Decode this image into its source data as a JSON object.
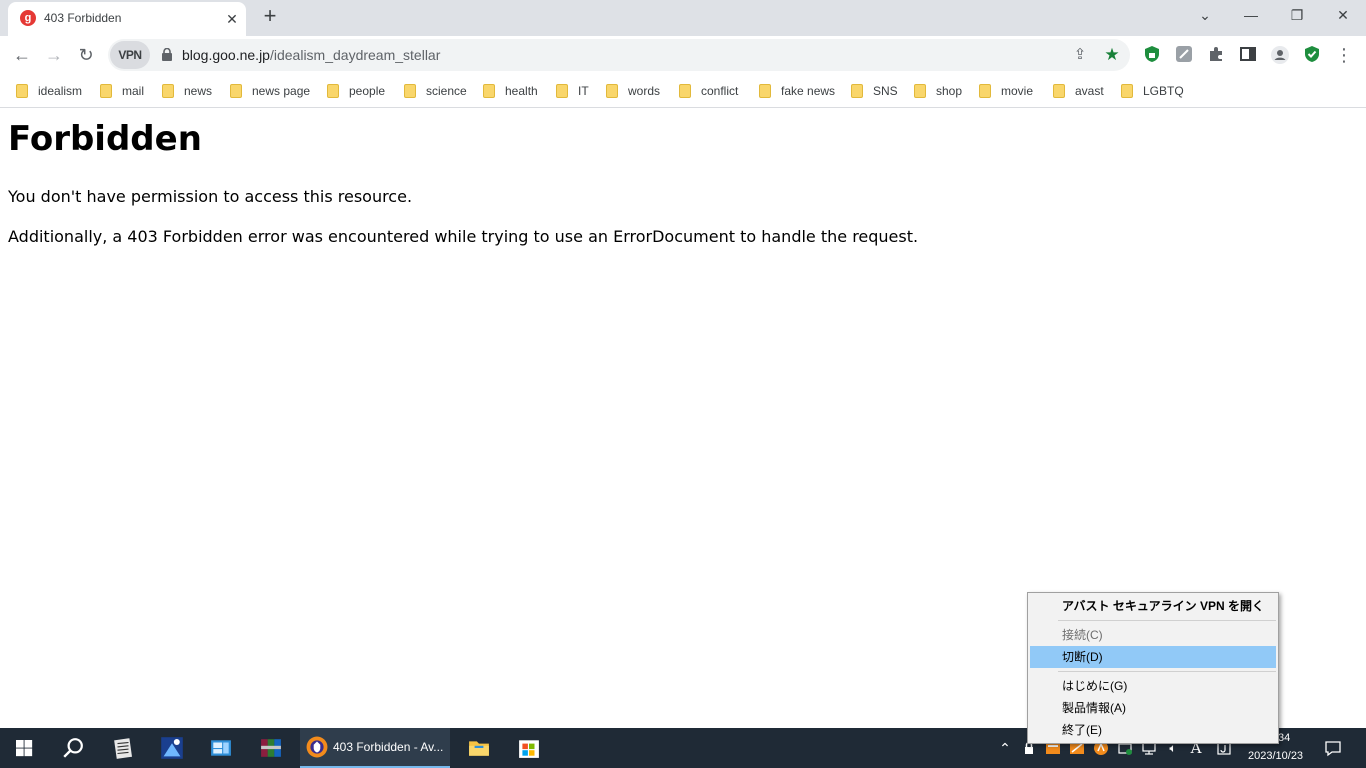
{
  "tab": {
    "title": "403 Forbidden",
    "favicon_icon": "goo-favicon-icon",
    "close_glyph": "✕"
  },
  "new_tab_glyph": "+",
  "window_controls": {
    "tabsearch": "⌄",
    "minimize": "—",
    "restore": "❐",
    "close": "✕"
  },
  "toolbar": {
    "back_glyph": "←",
    "forward_glyph": "→",
    "reload_glyph": "↻",
    "vpn_label": "VPN",
    "url_host": "blog.goo.ne.jp",
    "url_path": "/idealism_daydream_stellar",
    "share_glyph": "⇪",
    "star_glyph": "★",
    "menu_glyph": "⋮"
  },
  "bookmarks": [
    "idealism",
    "mail",
    "news",
    "news page",
    "people",
    "science",
    "health",
    "IT",
    "words",
    "conflict",
    "fake news",
    "SNS",
    "shop",
    "movie",
    "avast",
    "LGBTQ"
  ],
  "page": {
    "title": "Forbidden",
    "line1": "You don't have permission to access this resource.",
    "line2": "Additionally, a 403 Forbidden error was encountered while trying to use an ErrorDocument to handle the request."
  },
  "context_menu": {
    "open": "アバスト セキュアライン VPN を開く",
    "connect": "接続(C)",
    "disconnect": "切断(D)",
    "getting_started": "はじめに(G)",
    "product_info": "製品情報(A)",
    "exit": "終了(E)"
  },
  "taskbar": {
    "active_window": "403 Forbidden - Av...",
    "clock_time": "34",
    "clock_date": "2023/10/23",
    "ime": "A"
  },
  "colors": {
    "accent_highlight": "#91c9f7",
    "star_green": "#188038",
    "taskbar_bg": "#1f2a36"
  }
}
